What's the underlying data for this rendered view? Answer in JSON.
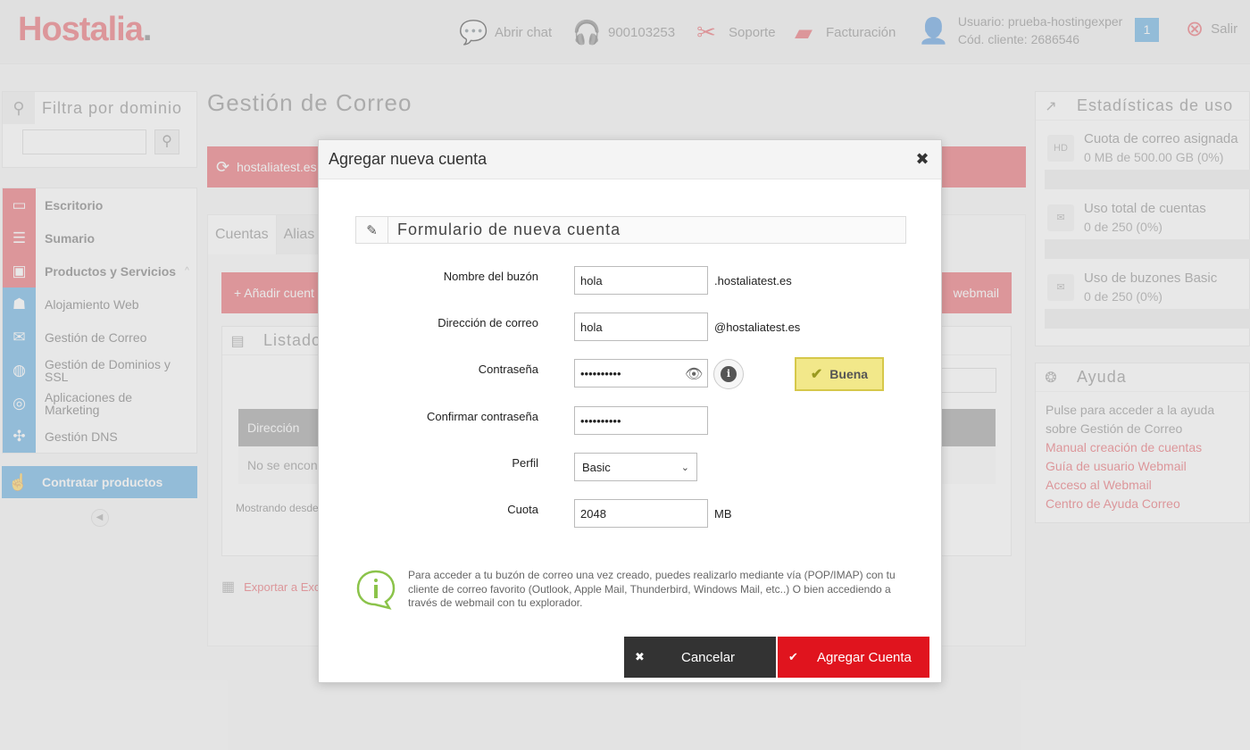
{
  "header": {
    "logo": "Hostalia",
    "logo_dot": ".",
    "chat": "Abrir chat",
    "phone": "900103253",
    "support": "Soporte",
    "billing": "Facturación",
    "user_line1": "Usuario: prueba-hostingexper",
    "user_line2": "Cód. cliente: 2686546",
    "notifications": "1",
    "logout": "Salir"
  },
  "sidebar": {
    "filter_title": "Filtra por dominio",
    "items": [
      {
        "label": "Escritorio",
        "icon": "monitor-icon"
      },
      {
        "label": "Sumario",
        "icon": "list-icon"
      },
      {
        "label": "Productos y Servicios",
        "icon": "briefcase-icon"
      },
      {
        "label": "Alojamiento Web",
        "icon": "server-icon"
      },
      {
        "label": "Gestión de Correo",
        "icon": "envelope-icon"
      },
      {
        "label": "Gestión de Dominios y SSL",
        "icon": "globe-icon"
      },
      {
        "label": "Aplicaciones de Marketing",
        "icon": "target-icon"
      },
      {
        "label": "Gestión DNS",
        "icon": "network-icon"
      }
    ],
    "contract_label": "Contratar productos"
  },
  "main": {
    "title": "Gestión de Correo",
    "domain": "hostaliatest.es",
    "tabs": [
      "Cuentas",
      "Alias"
    ],
    "add_account": "+ Añadir cuent",
    "webmail": "webmail",
    "list_title": "Listado",
    "col_address": "Dirección",
    "empty": "No se encon",
    "showing": "Mostrando desde",
    "export": "Exportar a Exce"
  },
  "right": {
    "stats_title": "Estadísticas de uso",
    "stats": [
      {
        "title": "Cuota de correo asignada",
        "value": "0 MB de 500.00 GB (0%)",
        "fraction": 0
      },
      {
        "title": "Uso total de cuentas",
        "value": "0 de 250 (0%)",
        "fraction": 0
      },
      {
        "title": "Uso de buzones Basic",
        "value": "0 de 250 (0%)",
        "fraction": 0
      }
    ],
    "help_title": "Ayuda",
    "help_text": "Pulse para acceder a la ayuda sobre Gestión de Correo",
    "help_links": [
      "Manual creación de cuentas",
      "Guía de usuario Webmail",
      "Acceso al Webmail",
      "Centro de Ayuda Correo"
    ]
  },
  "modal": {
    "title": "Agregar nueva cuenta",
    "close": "✖",
    "form_title": "Formulario de nueva cuenta",
    "fields": {
      "mailbox_label": "Nombre del buzón",
      "mailbox_value": "hola",
      "mailbox_suffix": ".hostaliatest.es",
      "email_label": "Dirección de correo",
      "email_value": "hola",
      "email_suffix": "@hostaliatest.es",
      "password_label": "Contraseña",
      "password_value": "••••••••••",
      "password_strength": "Buena",
      "confirm_label": "Confirmar contraseña",
      "confirm_value": "••••••••••",
      "profile_label": "Perfil",
      "profile_value": "Basic",
      "quota_label": "Cuota",
      "quota_value": "2048",
      "quota_unit": "MB"
    },
    "info_text": "Para acceder a tu buzón de correo una vez creado, puedes realizarlo mediante vía (POP/IMAP) con tu cliente de correo favorito (Outlook, Apple Mail, Thunderbird, Windows Mail, etc..) O bien accediendo a través de webmail con tu explorador.",
    "cancel": "Cancelar",
    "submit": "Agregar Cuenta"
  },
  "colors": {
    "brand_red": "#e0303a",
    "brand_blue": "#2a8fd6",
    "strength_yellow": "#f2e88a"
  }
}
